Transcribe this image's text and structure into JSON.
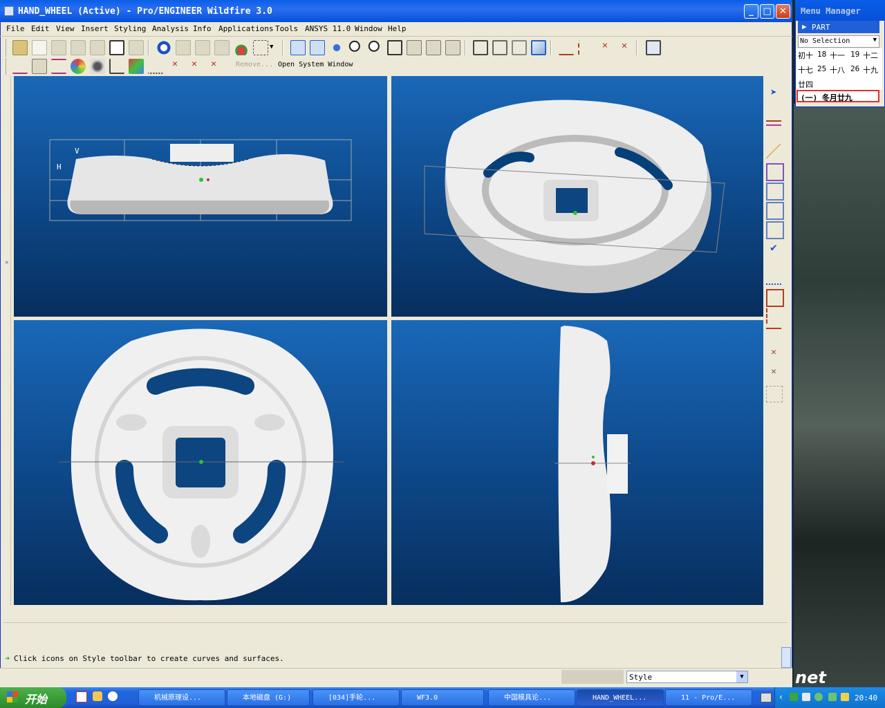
{
  "window": {
    "title": "HAND_WHEEL (Active) - Pro/ENGINEER Wildfire 3.0",
    "minimize_glyph": "_",
    "maximize_glyph": "□",
    "close_glyph": "✕"
  },
  "menubar": [
    "File",
    "Edit",
    "View",
    "Insert",
    "Styling",
    "Analysis",
    "Info",
    "Applications",
    "Tools",
    "ANSYS 11.0",
    "Window",
    "Help"
  ],
  "toolbar2": {
    "remove_label": "Remove...",
    "open_system_window_label": "Open System Window"
  },
  "viewport": {
    "front_axis_labels": [
      "V",
      "H"
    ]
  },
  "message": "Click icons on Style toolbar to create curves and surfaces.",
  "status": {
    "filter_value": "Style"
  },
  "menu_manager": {
    "title": "Menu Manager",
    "part_item": "PART",
    "selection_value": "No Selection",
    "calendar_rows": [
      [
        "初十",
        "18",
        "十一",
        "19",
        "十二"
      ],
      [
        "十七",
        "25",
        "十八",
        "26",
        "十九"
      ],
      [
        "廿四"
      ]
    ],
    "lunar_date": "(一) 冬月廿九"
  },
  "desktop": {
    "corner_text": "net"
  },
  "taskbar": {
    "start_label": "开始",
    "tasks": [
      "机械原理设...",
      "本地磁盘 (G:)",
      "[034]手轮...",
      "WF3.0",
      "中国模具论...",
      "HAND_WHEEL...",
      "11 - Pro/E..."
    ],
    "clock": "20:40"
  },
  "colors": {
    "titlebar": "#0a5ee8",
    "viewport_top": "#1a68b8",
    "viewport_bottom": "#072e5e",
    "part_surface": "#e8e8e8"
  }
}
